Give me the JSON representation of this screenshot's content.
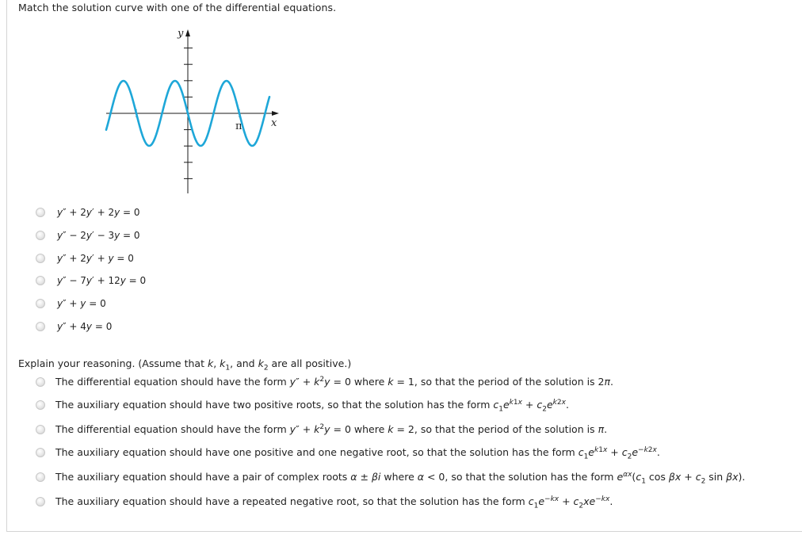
{
  "question": {
    "prompt": "Match the solution curve with one of the differential equations."
  },
  "graph": {
    "x_label": "x",
    "y_label": "y",
    "x_tick_label": "π",
    "curve_color": "#1ea7d8",
    "axis_color": "#1a1a1a",
    "function": "y = -sin(2x)",
    "x_range_shown": [
      "-1.83",
      "3.0"
    ],
    "x_ticks": [
      "-π/2",
      "π"
    ],
    "y_ticks_above": 4,
    "y_ticks_below": 4
  },
  "equations": [
    {
      "label": "y″ + 2y′ + 2y = 0",
      "selected": false
    },
    {
      "label": "y″ − 2y′ − 3y = 0",
      "selected": false
    },
    {
      "label": "y″ + 2y′ + y = 0",
      "selected": false
    },
    {
      "label": "y″ − 7y′ + 12y = 0",
      "selected": false
    },
    {
      "label": "y″ + y = 0",
      "selected": false
    },
    {
      "label": "y″ + 4y = 0",
      "selected": false
    }
  ],
  "explain": {
    "prompt_a": "Explain your reasoning. (Assume that ",
    "k": "k",
    "k1": "k",
    "k1_sub": "1",
    "k2": "k",
    "k2_sub": "2",
    "comma": ", ",
    "and": ", and ",
    "prompt_b": " are all positive.)",
    "options": [
      {
        "text": "The differential equation should have the form y″ + k²y = 0 where k = 1, so that the period of the solution is 2π.",
        "selected": false
      },
      {
        "text": "The auxiliary equation should have two positive roots, so that the solution has the form c₁e^(k₁x) + c₂e^(k₂x).",
        "selected": false
      },
      {
        "text": "The differential equation should have the form y″ + k²y = 0 where k = 2, so that the period of the solution is π.",
        "selected": false
      },
      {
        "text": "The auxiliary equation should have one positive and one negative root, so that the solution has the form c₁e^(k₁x) + c₂e^(−k₂x).",
        "selected": false
      },
      {
        "text": "The auxiliary equation should have a pair of complex roots α ± βi where α < 0, so that the solution has the form e^(αx)(c₁ cos βx + c₂ sin βx).",
        "selected": false
      },
      {
        "text": "The auxiliary equation should have a repeated negative root, so that the solution has the form c₁e^(−kx) + c₂xe^(−kx).",
        "selected": false
      }
    ]
  }
}
